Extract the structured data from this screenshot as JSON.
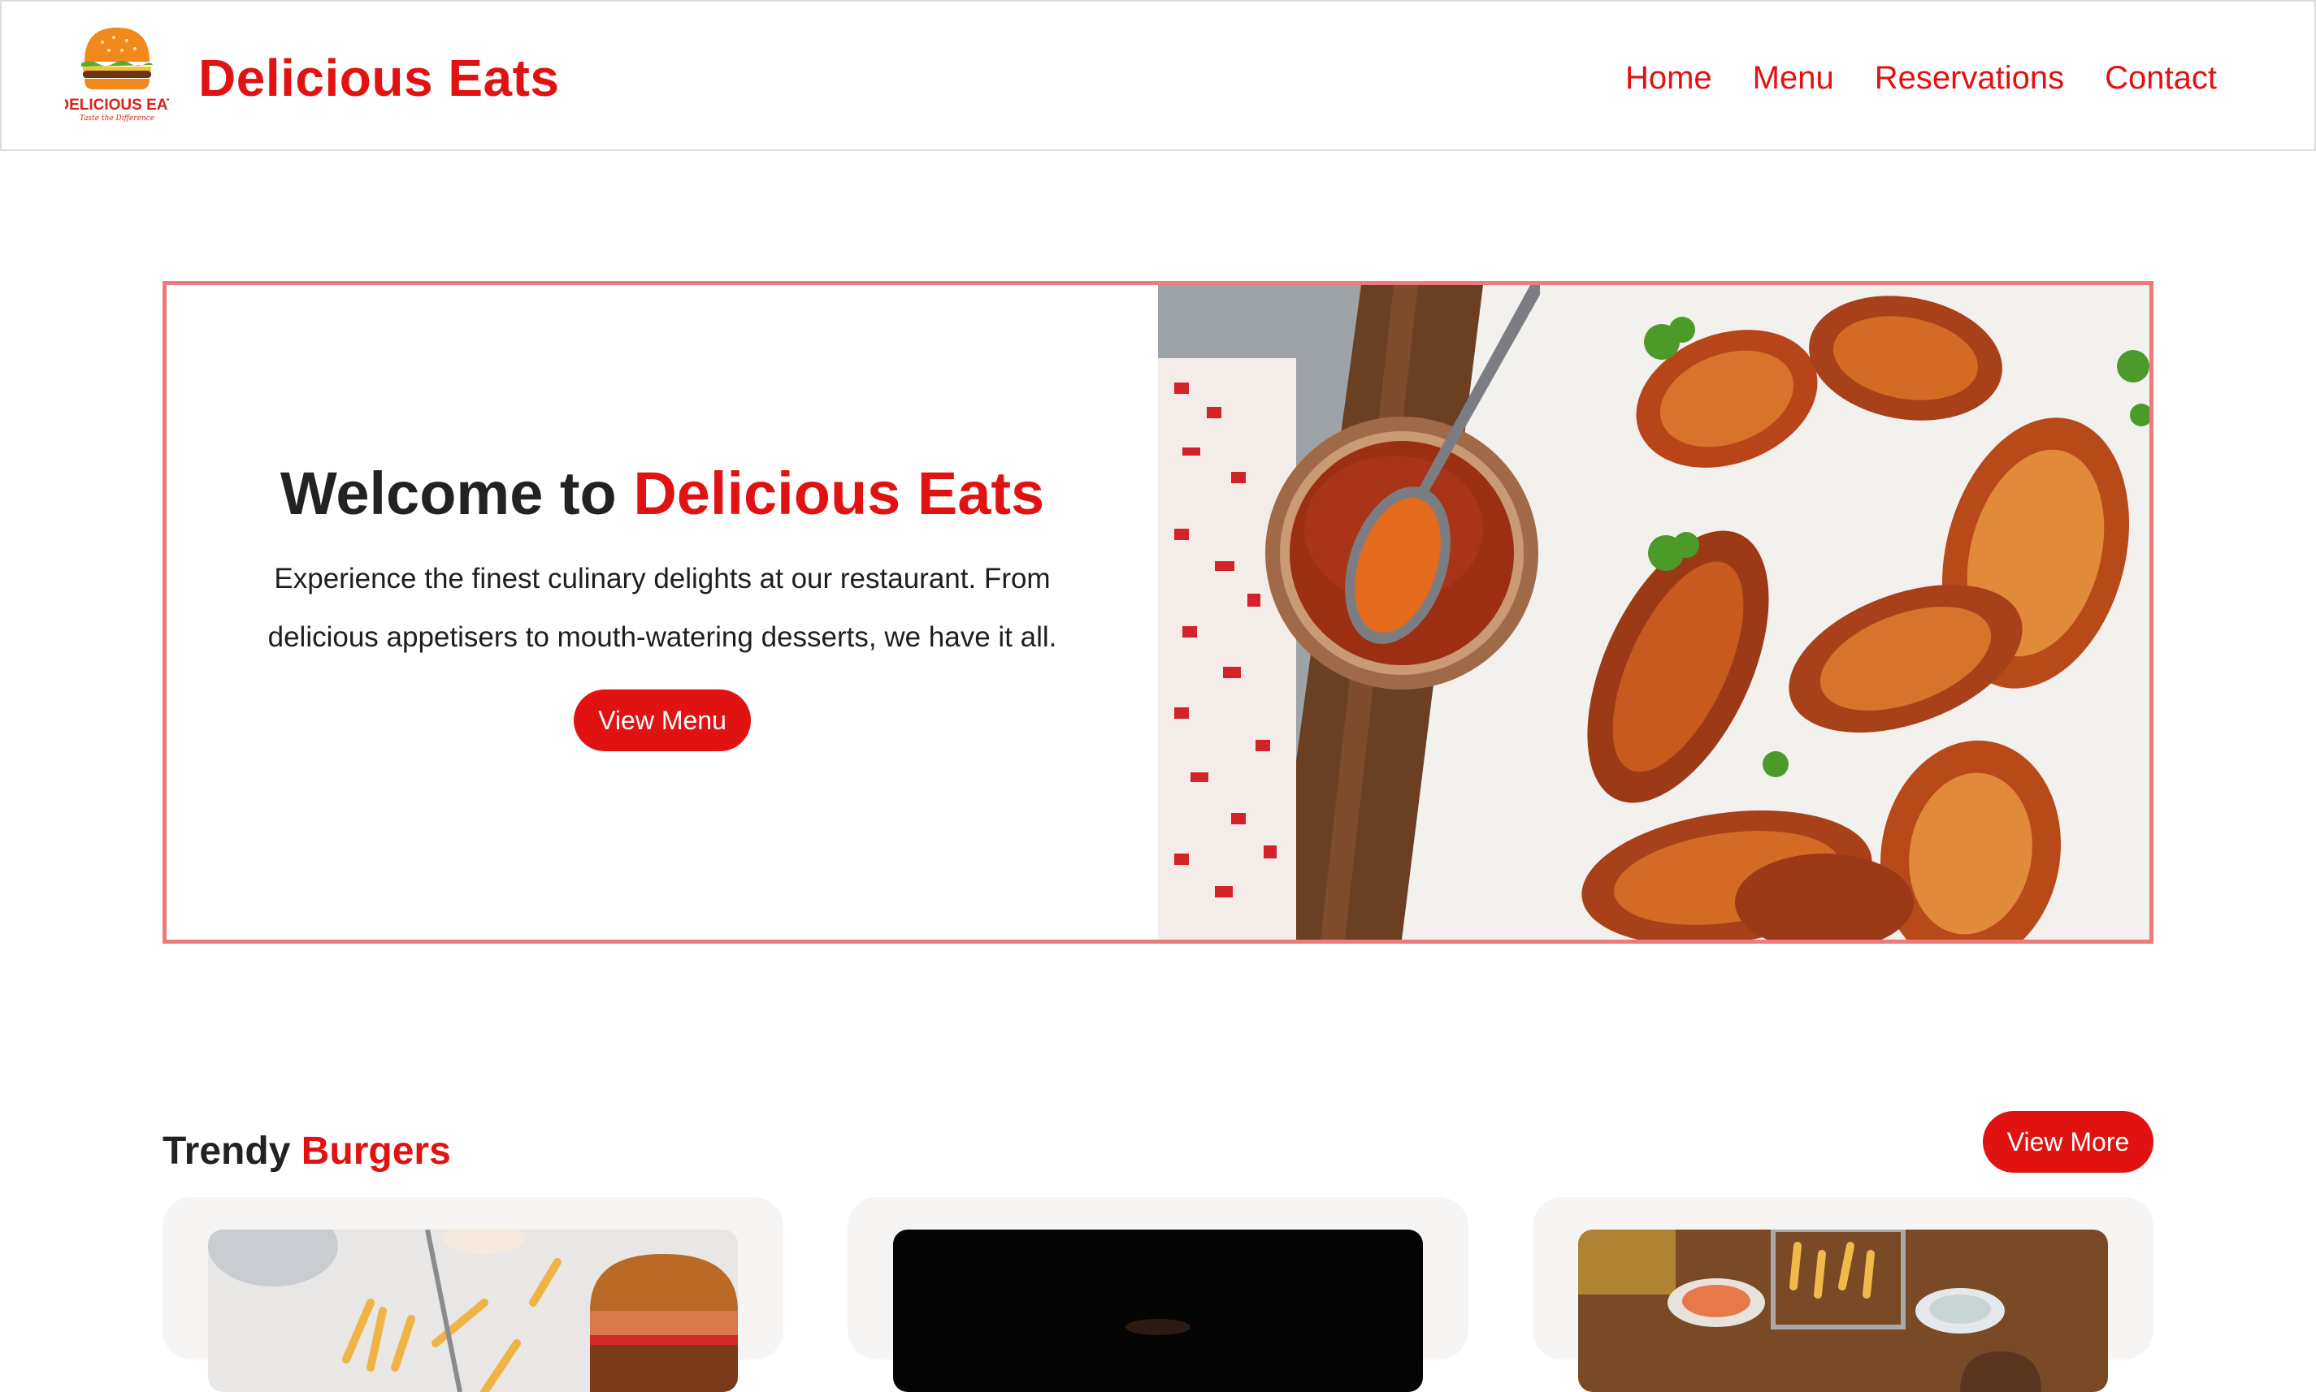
{
  "header": {
    "logo_text": "DELICIOUS EAT",
    "logo_tagline": "Taste the Difference",
    "site_title": "Delicious Eats",
    "nav": [
      "Home",
      "Menu",
      "Reservations",
      "Contact"
    ]
  },
  "hero": {
    "title_prefix": "Welcome to ",
    "title_accent": "Delicious Eats",
    "description": "Experience the finest culinary delights at our restaurant. From delicious appetisers to mouth-watering desserts, we have it all.",
    "button_label": "View Menu",
    "image_icon": "chicken-wings-photo"
  },
  "trendy": {
    "title_prefix": "Trendy ",
    "title_accent": "Burgers",
    "view_more_label": "View More",
    "cards": [
      {
        "image_icon": "burger-fries-photo"
      },
      {
        "image_icon": "burger-dark-photo"
      },
      {
        "image_icon": "burger-table-photo"
      }
    ]
  },
  "colors": {
    "accent": "#e01212",
    "hero_border": "#ee7b7b",
    "card_bg": "#f6f5f3"
  }
}
